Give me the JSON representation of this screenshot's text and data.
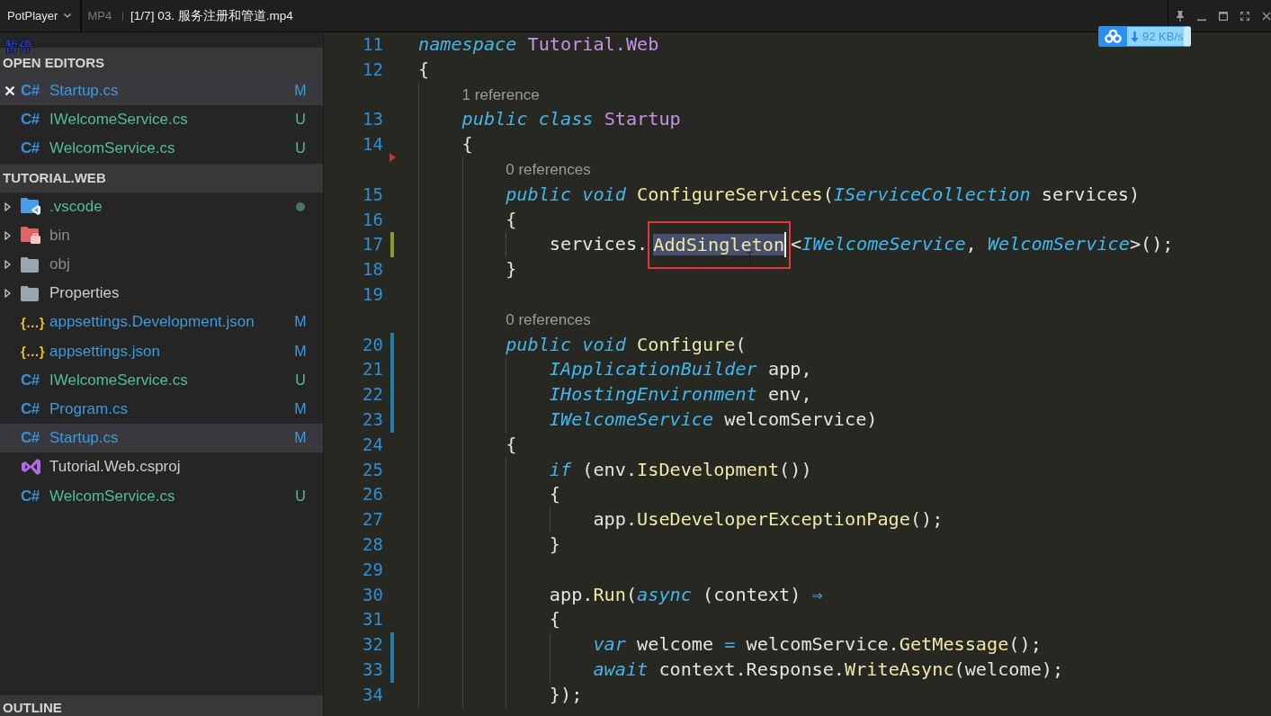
{
  "player": {
    "app_menu": "PotPlayer",
    "format": "MP4",
    "title": "[1/7] 03. 服务注册和管道.mp4"
  },
  "osd": {
    "status": "暂停"
  },
  "download_badge": {
    "speed": "92 KB/s"
  },
  "sidebar": {
    "sections": [
      {
        "kind": "open-editors",
        "title": "OPEN EDITORS",
        "items": [
          {
            "name": "Startup.cs",
            "kind": "csharp",
            "icon_text": "C#",
            "color": "#3d9ad8",
            "status": "M",
            "dot": false,
            "selected": true
          },
          {
            "name": "IWelcomeService.cs",
            "kind": "csharp",
            "icon_text": "C#",
            "color": "#52bd9e",
            "status": "U",
            "dot": false,
            "selected": false
          },
          {
            "name": "WelcomService.cs",
            "kind": "csharp",
            "icon_text": "C#",
            "color": "#52bd9e",
            "status": "U",
            "dot": false,
            "selected": false
          }
        ]
      },
      {
        "kind": "explorer",
        "title": "TUTORIAL.WEB",
        "items": [
          {
            "name": ".vscode",
            "kind": "vscode",
            "expanded": false,
            "color": "#52bd9e",
            "dot": true,
            "selected": false
          },
          {
            "name": "bin",
            "kind": "bin",
            "expanded": false,
            "color": "#8a8a8a",
            "dot": false,
            "selected": false
          },
          {
            "name": "obj",
            "kind": "folder",
            "expanded": false,
            "color": "#8a8a8a",
            "dot": false,
            "selected": false
          },
          {
            "name": "Properties",
            "kind": "folder",
            "expanded": false,
            "color": "#cccccc",
            "dot": false,
            "selected": false
          },
          {
            "name": "appsettings.Development.json",
            "kind": "json",
            "icon_text": "{…}",
            "color": "#3d9ad8",
            "status": "M",
            "dot": false,
            "selected": false
          },
          {
            "name": "appsettings.json",
            "kind": "json",
            "icon_text": "{…}",
            "color": "#3d9ad8",
            "status": "M",
            "dot": false,
            "selected": false
          },
          {
            "name": "IWelcomeService.cs",
            "kind": "csharp",
            "icon_text": "C#",
            "color": "#52bd9e",
            "status": "U",
            "dot": false,
            "selected": false
          },
          {
            "name": "Program.cs",
            "kind": "csharp",
            "icon_text": "C#",
            "color": "#3d9ad8",
            "status": "M",
            "dot": false,
            "selected": false
          },
          {
            "name": "Startup.cs",
            "kind": "csharp",
            "icon_text": "C#",
            "color": "#3d9ad8",
            "status": "M",
            "dot": false,
            "selected": true
          },
          {
            "name": "Tutorial.Web.csproj",
            "kind": "project",
            "color": "#cccccc",
            "dot": false,
            "selected": false
          },
          {
            "name": "WelcomService.cs",
            "kind": "csharp",
            "icon_text": "C#",
            "color": "#52bd9e",
            "status": "U",
            "dot": false,
            "selected": false
          }
        ]
      },
      {
        "kind": "outline",
        "title": "OUTLINE"
      }
    ]
  },
  "editor": {
    "lines": [
      {
        "kind": "code",
        "number": "11",
        "tokens": [
          {
            "kind": "keyword",
            "text": "namespace "
          },
          {
            "kind": "class",
            "text": "Tutorial.Web"
          }
        ]
      },
      {
        "kind": "code",
        "number": "12",
        "tokens": [
          {
            "kind": "plain",
            "text": "{"
          }
        ]
      },
      {
        "kind": "lens",
        "text": "1 reference"
      },
      {
        "kind": "code",
        "number": "13",
        "tokens": [
          {
            "kind": "keyword",
            "text": "    public class "
          },
          {
            "kind": "class",
            "text": "Startup"
          }
        ]
      },
      {
        "kind": "code",
        "number": "14",
        "gutter": {
          "kind": "deleted"
        },
        "tokens": [
          {
            "kind": "plain",
            "text": "    {"
          }
        ]
      },
      {
        "kind": "lens",
        "text": "0 references"
      },
      {
        "kind": "code",
        "number": "15",
        "tokens": [
          {
            "kind": "keyword",
            "text": "        public void "
          },
          {
            "kind": "method",
            "text": "ConfigureServices"
          },
          {
            "kind": "plain",
            "text": "("
          },
          {
            "kind": "type",
            "text": "IServiceCollection"
          },
          {
            "kind": "plain",
            "text": " services)"
          }
        ]
      },
      {
        "kind": "code",
        "number": "16",
        "tokens": [
          {
            "kind": "plain",
            "text": "        {"
          }
        ]
      },
      {
        "kind": "code",
        "number": "17",
        "gutter": {
          "kind": "added"
        },
        "tokens": [
          {
            "kind": "plain",
            "text": "            services."
          },
          {
            "kind": "selection",
            "text": "AddSingleton"
          },
          {
            "kind": "plain",
            "text": "<"
          },
          {
            "kind": "type",
            "text": "IWelcomeService"
          },
          {
            "kind": "plain",
            "text": ", "
          },
          {
            "kind": "type",
            "text": "WelcomService"
          },
          {
            "kind": "plain",
            "text": ">();"
          }
        ]
      },
      {
        "kind": "code",
        "number": "18",
        "tokens": [
          {
            "kind": "plain",
            "text": "        }"
          }
        ]
      },
      {
        "kind": "code",
        "number": "19"
      },
      {
        "kind": "lens",
        "text": "0 references"
      },
      {
        "kind": "code",
        "number": "20",
        "gutter": {
          "kind": "modified"
        },
        "tokens": [
          {
            "kind": "keyword",
            "text": "        public void "
          },
          {
            "kind": "method",
            "text": "Configure"
          },
          {
            "kind": "plain",
            "text": "("
          }
        ]
      },
      {
        "kind": "code",
        "number": "21",
        "gutter": {
          "kind": "modified"
        },
        "tokens": [
          {
            "kind": "type",
            "text": "            IApplicationBuilder"
          },
          {
            "kind": "plain",
            "text": " app,"
          }
        ]
      },
      {
        "kind": "code",
        "number": "22",
        "gutter": {
          "kind": "modified"
        },
        "tokens": [
          {
            "kind": "type",
            "text": "            IHostingEnvironment"
          },
          {
            "kind": "plain",
            "text": " env,"
          }
        ]
      },
      {
        "kind": "code",
        "number": "23",
        "gutter": {
          "kind": "modified"
        },
        "tokens": [
          {
            "kind": "type",
            "text": "            IWelcomeService"
          },
          {
            "kind": "plain",
            "text": " welcomService)"
          }
        ]
      },
      {
        "kind": "code",
        "number": "24",
        "tokens": [
          {
            "kind": "plain",
            "text": "        {"
          }
        ]
      },
      {
        "kind": "code",
        "number": "25",
        "tokens": [
          {
            "kind": "keyword",
            "text": "            if"
          },
          {
            "kind": "plain",
            "text": " (env."
          },
          {
            "kind": "method",
            "text": "IsDevelopment"
          },
          {
            "kind": "plain",
            "text": "())"
          }
        ]
      },
      {
        "kind": "code",
        "number": "26",
        "tokens": [
          {
            "kind": "plain",
            "text": "            {"
          }
        ]
      },
      {
        "kind": "code",
        "number": "27",
        "tokens": [
          {
            "kind": "plain",
            "text": "                app."
          },
          {
            "kind": "method",
            "text": "UseDeveloperExceptionPage"
          },
          {
            "kind": "plain",
            "text": "();"
          }
        ]
      },
      {
        "kind": "code",
        "number": "28",
        "tokens": [
          {
            "kind": "plain",
            "text": "            }"
          }
        ]
      },
      {
        "kind": "code",
        "number": "29"
      },
      {
        "kind": "code",
        "number": "30",
        "tokens": [
          {
            "kind": "plain",
            "text": "            app."
          },
          {
            "kind": "method",
            "text": "Run"
          },
          {
            "kind": "plain",
            "text": "("
          },
          {
            "kind": "keyword",
            "text": "async"
          },
          {
            "kind": "plain",
            "text": " (context) "
          },
          {
            "kind": "operator",
            "text": "⇒"
          }
        ]
      },
      {
        "kind": "code",
        "number": "31",
        "tokens": [
          {
            "kind": "plain",
            "text": "            {"
          }
        ]
      },
      {
        "kind": "code",
        "number": "32",
        "gutter": {
          "kind": "modified"
        },
        "tokens": [
          {
            "kind": "keyword",
            "text": "                var"
          },
          {
            "kind": "plain",
            "text": " welcome "
          },
          {
            "kind": "operator",
            "text": "="
          },
          {
            "kind": "plain",
            "text": " welcomService."
          },
          {
            "kind": "method",
            "text": "GetMessage"
          },
          {
            "kind": "plain",
            "text": "();"
          }
        ]
      },
      {
        "kind": "code",
        "number": "33",
        "gutter": {
          "kind": "modified"
        },
        "tokens": [
          {
            "kind": "keyword",
            "text": "                await"
          },
          {
            "kind": "plain",
            "text": " context.Response."
          },
          {
            "kind": "method",
            "text": "WriteAsync"
          },
          {
            "kind": "plain",
            "text": "(welcome);"
          }
        ]
      },
      {
        "kind": "code",
        "number": "34",
        "tokens": [
          {
            "kind": "plain",
            "text": "            });"
          }
        ]
      }
    ]
  }
}
